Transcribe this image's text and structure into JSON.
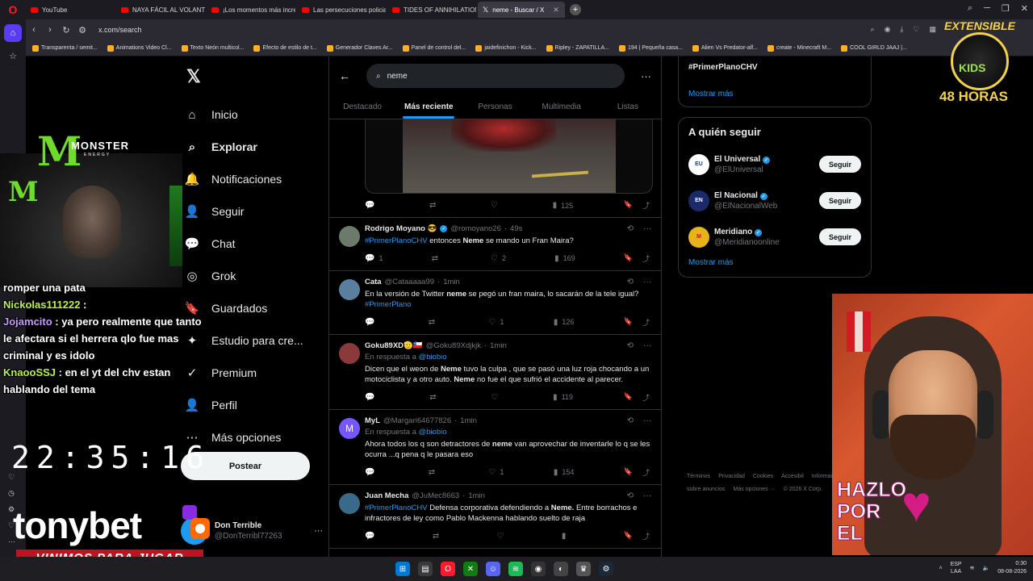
{
  "browser": {
    "tabs": [
      {
        "label": "YouTube",
        "active": false
      },
      {
        "label": "NAYA FÁCIL AL VOLANTE",
        "active": false
      },
      {
        "label": "¡Los momentos más incre",
        "active": false
      },
      {
        "label": "Las persecuciones policial",
        "active": false
      },
      {
        "label": "TIDES OF ANNIHILATION",
        "active": false
      },
      {
        "label": "neme - Buscar / X",
        "active": true
      }
    ],
    "url": "x.com/search",
    "bookmarks": [
      "Transparenta / semit...",
      "Animations Video Cl...",
      "Texto Neón multicol...",
      "Efecto de estilo de t...",
      "Generador Claves Ar...",
      "Panel de control del...",
      "jaidefinichon - Kick...",
      "Ripley - ZAPATILLA...",
      "194 | Pequeña casa...",
      "Alien Vs Predator-alf...",
      "create - Minecraft M...",
      "COOL GIRLD JAAJ |..."
    ]
  },
  "x": {
    "nav": [
      {
        "label": "Inicio",
        "icon": "home-icon",
        "glyph": "⌂"
      },
      {
        "label": "Explorar",
        "icon": "search-icon",
        "glyph": "⌕",
        "bold": true
      },
      {
        "label": "Notificaciones",
        "icon": "bell-icon",
        "glyph": "🔔"
      },
      {
        "label": "Seguir",
        "icon": "follow-icon",
        "glyph": "👤"
      },
      {
        "label": "Chat",
        "icon": "chat-icon",
        "glyph": "💬"
      },
      {
        "label": "Grok",
        "icon": "grok-icon",
        "glyph": "◎"
      },
      {
        "label": "Guardados",
        "icon": "bookmark-icon",
        "glyph": "🔖"
      },
      {
        "label": "Estudio para cre...",
        "icon": "studio-icon",
        "glyph": "✦"
      },
      {
        "label": "Premium",
        "icon": "premium-icon",
        "glyph": "✓"
      },
      {
        "label": "Perfil",
        "icon": "profile-icon",
        "glyph": "👤"
      },
      {
        "label": "Más opciones",
        "icon": "more-icon",
        "glyph": "⋯"
      }
    ],
    "post_button": "Postear",
    "account": {
      "name": "Don Terrible",
      "handle": "@DonTerribl77263"
    },
    "search": {
      "query": "neme"
    },
    "tabs": [
      "Destacado",
      "Más reciente",
      "Personas",
      "Multimedia",
      "Listas"
    ],
    "active_tab": "Más reciente",
    "media_post": {
      "replies": "",
      "reposts": "",
      "likes": "",
      "views": "125"
    },
    "posts": [
      {
        "name": "Rodrigo Moyano 😎",
        "verified": true,
        "handle": "@romoyano26",
        "time": "49s",
        "avatar_color": "#6b7a6a",
        "reply_to": "",
        "text_html": "<span class=\"hl\">#PrimerPlanoCHV</span> entonces <b>Neme</b> se mando un Fran Maira?",
        "replies": "1",
        "reposts": "",
        "likes": "2",
        "views": "169"
      },
      {
        "name": "Cata",
        "verified": false,
        "handle": "@Cataaaaa99",
        "time": "1min",
        "avatar_color": "#5a7ea0",
        "reply_to": "",
        "text_html": "En la versión de Twitter <b>neme</b> se pegó un fran maira, lo sacarán de la tele igual? <span class=\"hl\">#PrimerPlano</span>",
        "replies": "",
        "reposts": "",
        "likes": "1",
        "views": "126"
      },
      {
        "name": "Goku89XD🫡🇨🇱",
        "verified": false,
        "handle": "@Goku89Xdjkjk",
        "time": "1min",
        "avatar_color": "#8a3a3a",
        "reply_to": "@biobio",
        "text_html": "Dicen que el weon de <b>Neme</b> tuvo la culpa , que se pasó una luz roja chocando a un motociclista y a otro auto. <b>Neme</b> no fue el que sufrió el accidente al parecer.",
        "replies": "",
        "reposts": "",
        "likes": "",
        "views": "119"
      },
      {
        "name": "MyL",
        "verified": false,
        "handle": "@Margari64677826",
        "time": "1min",
        "avatar_color": "#7856ff",
        "avatar_letter": "M",
        "reply_to": "@biobio",
        "text_html": "Ahora todos los q son detractores de <b>neme</b> van aprovechar de inventarle lo q se les ocurra ...q pena q le pasara eso",
        "replies": "",
        "reposts": "",
        "likes": "1",
        "views": "154"
      },
      {
        "name": "Juan Mecha",
        "verified": false,
        "handle": "@JuMec8663",
        "time": "1min",
        "avatar_color": "#3a6a8a",
        "reply_to": "",
        "text_html": "<span class=\"hl\">#PrimerPlanoCHV</span> Defensa corporativa defendiendo a <b>Neme.</b> Entre borrachos e infractores de ley como Pablo Mackenna hablando suelto de raja",
        "replies": "",
        "reposts": "",
        "likes": "",
        "views": ""
      }
    ],
    "replying_label": "En respuesta a",
    "trend": {
      "tag": "#PrimerPlanoCHV",
      "more": "Mostrar más"
    },
    "who_to_follow": {
      "title": "A quién seguir",
      "accounts": [
        {
          "name": "El Universal",
          "handle": "@ElUniversal",
          "logo": "EU",
          "color": "#ffffff",
          "text_color": "#1a3a7a"
        },
        {
          "name": "El Nacional",
          "handle": "@ElNacionalWeb",
          "logo": "EN",
          "color": "#1a2a6a",
          "text_color": "#ffffff"
        },
        {
          "name": "Meridiano",
          "handle": "@Meridianoonline",
          "logo": "M",
          "color": "#e8b21a",
          "text_color": "#c0101a"
        }
      ],
      "follow_label": "Seguir",
      "more": "Mostrar más"
    },
    "footer": [
      "Términos",
      "Privacidad",
      "Cookies",
      "Accesibil",
      "Información sobre anuncios",
      "Más opciones ···",
      "© 2026 X Corp."
    ]
  },
  "overlay": {
    "chat": [
      {
        "user": "",
        "text": "romper una pata"
      },
      {
        "user": "Nickolas111222",
        "text": ":"
      },
      {
        "user": "Jojamcito",
        "text": ": ya pero realmente que tanto le afectara si el herrera qlo fue mas criminal y es idolo"
      },
      {
        "user": "KnaooSSJ",
        "text": ": en el yt del chv estan hablando del tema"
      }
    ],
    "clock": "22:35:16",
    "sponsor": "tonybet",
    "slogan": "VINIMOS PARA JUGAR",
    "badge_top": "EXTENSIBLE",
    "badge_mid": "KIDS",
    "badge_bottom": "48 HORAS",
    "monster_brand": "MONSTER",
    "monster_sub": "ENERGY",
    "hazlo": [
      "HAZLO",
      "POR",
      "EL"
    ]
  },
  "taskbar": {
    "lang": "ESP",
    "lang2": "LAA",
    "time": "0:30",
    "date": "08-08-2026"
  }
}
